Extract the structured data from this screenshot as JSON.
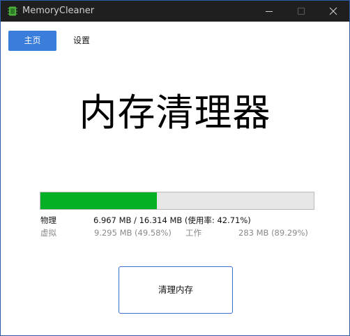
{
  "window": {
    "title": "MemoryCleaner"
  },
  "nav": {
    "home_label": "主页",
    "settings_label": "设置"
  },
  "main": {
    "heading": "内存清理器"
  },
  "memory": {
    "usage_fraction": 0.4271,
    "physical_label": "物理",
    "physical_value": "6.967 MB / 16.314 MB (使用率: 42.71%)",
    "virtual_label": "虚拟",
    "virtual_value": "9.295 MB (49.58%)",
    "working_label": "工作",
    "working_value": "283 MB (89.29%)"
  },
  "actions": {
    "clean_label": "清理内存"
  },
  "colors": {
    "accent": "#3b7ddb",
    "progress_fill": "#06b025",
    "titlebar": "#1f1f1f"
  },
  "icons": {
    "app": "chip-icon",
    "minimize": "minimize-icon",
    "maximize": "maximize-icon",
    "close": "close-icon"
  }
}
